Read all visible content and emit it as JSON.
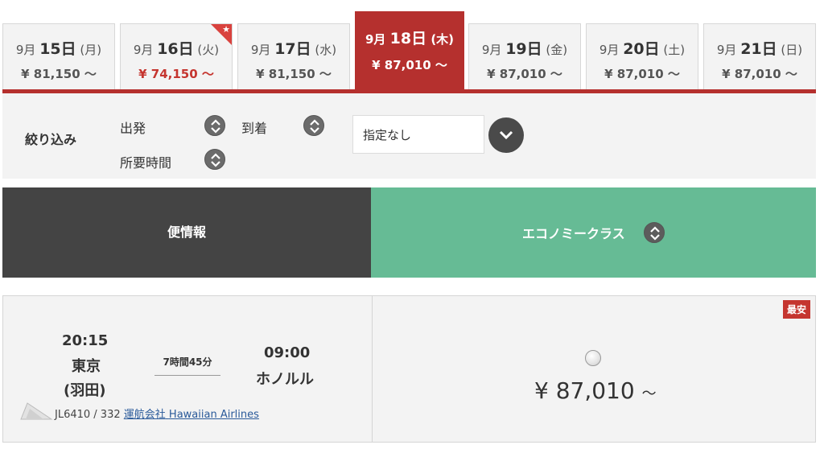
{
  "date_tabs": [
    {
      "month": "9月",
      "day": "15日",
      "weekday": "(月)",
      "price": "¥ 81,150 ～",
      "selected": false,
      "lowest": false
    },
    {
      "month": "9月",
      "day": "16日",
      "weekday": "(火)",
      "price": "¥ 74,150 ～",
      "selected": false,
      "lowest": true
    },
    {
      "month": "9月",
      "day": "17日",
      "weekday": "(水)",
      "price": "¥ 81,150 ～",
      "selected": false,
      "lowest": false
    },
    {
      "month": "9月",
      "day": "18日",
      "weekday": "(木)",
      "price": "¥ 87,010 ～",
      "selected": true,
      "lowest": false
    },
    {
      "month": "9月",
      "day": "19日",
      "weekday": "(金)",
      "price": "¥ 87,010 ～",
      "selected": false,
      "lowest": false
    },
    {
      "month": "9月",
      "day": "20日",
      "weekday": "(土)",
      "price": "¥ 87,010 ～",
      "selected": false,
      "lowest": false
    },
    {
      "month": "9月",
      "day": "21日",
      "weekday": "(日)",
      "price": "¥ 87,010 ～",
      "selected": false,
      "lowest": false
    }
  ],
  "filter": {
    "title": "絞り込み",
    "departure_label": "出発",
    "arrival_label": "到着",
    "duration_label": "所要時間",
    "select_value": "指定なし"
  },
  "table_header": {
    "flight_info": "便情報",
    "fare_class": "エコノミークラス"
  },
  "flight": {
    "dep_time": "20:15",
    "dep_city": "東京",
    "dep_airport": "(羽田)",
    "duration": "7時間45分",
    "arr_time": "09:00",
    "arr_city": "ホノルル",
    "flight_number": "JL6410 / 332",
    "operator_label": "運航会社",
    "operator_name": "Hawaiian Airlines",
    "badge": "最安",
    "price": "¥ 87,010",
    "price_tilde": "～"
  },
  "colors": {
    "brand_red": "#b5302e",
    "economy_green": "#66bb95",
    "header_dark": "#444444"
  }
}
